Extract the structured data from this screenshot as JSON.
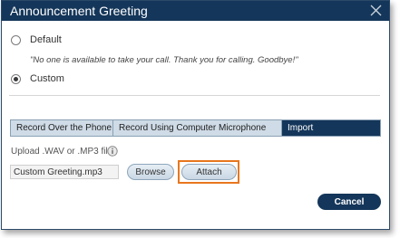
{
  "dialog": {
    "title": "Announcement Greeting",
    "close_icon": "close-icon"
  },
  "options": {
    "default_label": "Default",
    "default_message": "\"No one is available to take your call. Thank you for calling. Goodbye!\"",
    "custom_label": "Custom",
    "selected": "Custom"
  },
  "tabs": [
    {
      "label": "Record Over the Phone",
      "active": false
    },
    {
      "label": "Record Using Computer Microphone",
      "active": false
    },
    {
      "label": "Import",
      "active": true
    }
  ],
  "upload": {
    "label": "Upload .WAV or .MP3 file:",
    "info_icon": "info-icon",
    "file_value": "Custom Greeting.mp3",
    "browse_label": "Browse",
    "attach_label": "Attach"
  },
  "footer": {
    "cancel_label": "Cancel"
  },
  "colors": {
    "header": "#14365a",
    "tab_inactive": "#cfdbe6",
    "highlight": "#e8771e"
  }
}
